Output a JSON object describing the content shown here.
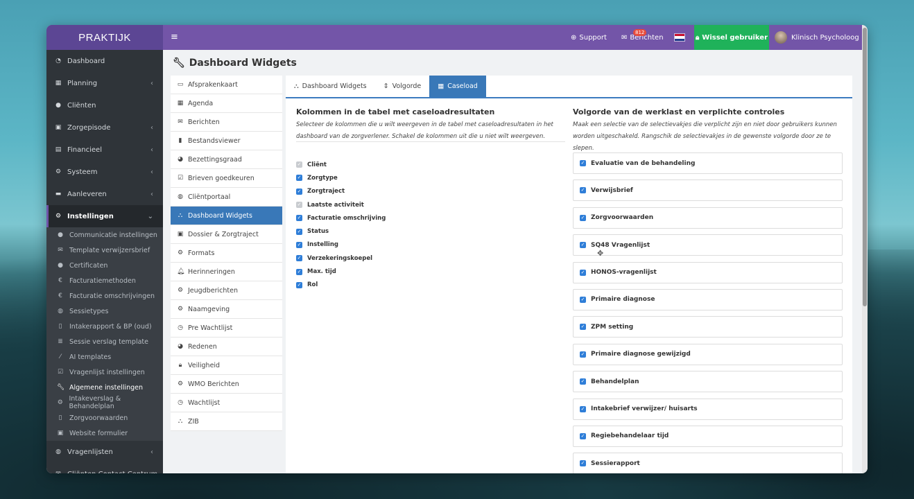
{
  "brand": "PRAKTIJK",
  "topbar": {
    "support": "Support",
    "berichten": "Berichten",
    "berichten_badge": "812",
    "wissel": "Wissel gebruiker",
    "user": "Klinisch Psycholoog"
  },
  "sidebar": {
    "items": [
      {
        "label": "Dashboard",
        "icon": "dashboard-icon"
      },
      {
        "label": "Planning",
        "icon": "calendar-icon",
        "chevron": "‹"
      },
      {
        "label": "Cliënten",
        "icon": "user-icon"
      },
      {
        "label": "Zorgepisode",
        "icon": "briefcase-icon",
        "chevron": "‹"
      },
      {
        "label": "Financieel",
        "icon": "book-icon",
        "chevron": "‹"
      },
      {
        "label": "Systeem",
        "icon": "gears-icon",
        "chevron": "‹"
      },
      {
        "label": "Aanleveren",
        "icon": "truck-icon",
        "chevron": "‹"
      },
      {
        "label": "Instellingen",
        "icon": "gear-icon",
        "chevron": "⌄"
      }
    ],
    "sub_items": [
      {
        "label": "Communicatie instellingen",
        "icon": "comments-icon"
      },
      {
        "label": "Template verwijzersbrief",
        "icon": "envelope-icon"
      },
      {
        "label": "Certificaten",
        "icon": "certificate-icon"
      },
      {
        "label": "Facturatiemethoden",
        "icon": "euro-icon"
      },
      {
        "label": "Facturatie omschrijvingen",
        "icon": "euro-icon"
      },
      {
        "label": "Sessietypes",
        "icon": "globe-icon"
      },
      {
        "label": "Intakerapport & BP (oud)",
        "icon": "file-icon"
      },
      {
        "label": "Sessie verslag template",
        "icon": "list-icon"
      },
      {
        "label": "AI templates",
        "icon": "magic-icon"
      },
      {
        "label": "Vragenlijst instellingen",
        "icon": "check-square-icon"
      },
      {
        "label": "Algemene instellingen",
        "icon": "wrench-icon"
      },
      {
        "label": "Intakeverslag & Behandelplan",
        "icon": "gear-icon"
      },
      {
        "label": "Zorgvoorwaarden",
        "icon": "document-icon"
      },
      {
        "label": "Website formulier",
        "icon": "briefcase-icon"
      }
    ],
    "after_items": [
      {
        "label": "Vragenlijsten",
        "icon": "question-icon",
        "chevron": "‹"
      },
      {
        "label": "Cliënten Contact Centrum",
        "icon": "envelope-icon",
        "chevron": "‹"
      }
    ]
  },
  "page_title": "Dashboard Widgets",
  "left_nav": [
    "Afsprakenkaart",
    "Agenda",
    "Berichten",
    "Bestandsviewer",
    "Bezettingsgraad",
    "Brieven goedkeuren",
    "Cliëntportaal",
    "Dashboard Widgets",
    "Dossier & Zorgtraject",
    "Formats",
    "Herinneringen",
    "Jeugdberichten",
    "Naamgeving",
    "Pre Wachtlijst",
    "Redenen",
    "Veiligheid",
    "WMO Berichten",
    "Wachtlijst",
    "ZIB"
  ],
  "left_nav_active": "Dashboard Widgets",
  "tabs": [
    {
      "label": "Dashboard Widgets",
      "icon": "sitemap-icon"
    },
    {
      "label": "Volgorde",
      "icon": "sort-icon"
    },
    {
      "label": "Caseload",
      "icon": "table-icon"
    }
  ],
  "columns_section": {
    "title": "Kolommen in de tabel met caseloadresultaten",
    "description_line1": "Selecteer de kolommen die u wilt weergeven in de tabel met caseloadresultaten in het",
    "description_line2": "dashboard van de zorgverlener. Schakel de kolommen uit die u niet wilt weergeven.",
    "columns": [
      {
        "label": "Cliënt",
        "checked": true,
        "disabled": true
      },
      {
        "label": "Zorgtype",
        "checked": true
      },
      {
        "label": "Zorgtraject",
        "checked": true
      },
      {
        "label": "Laatste activiteit",
        "checked": true,
        "disabled": true
      },
      {
        "label": "Facturatie omschrijving",
        "checked": true
      },
      {
        "label": "Status",
        "checked": true
      },
      {
        "label": "Instelling",
        "checked": true
      },
      {
        "label": "Verzekeringskoepel",
        "checked": true
      },
      {
        "label": "Max. tijd",
        "checked": true
      },
      {
        "label": "Rol",
        "checked": true
      }
    ]
  },
  "order_section": {
    "title": "Volgorde van de werklast en verplichte controles",
    "description_line1": "Maak een selectie van de selectievakjes die verplicht zijn en niet door gebruikers kunnen",
    "description_line2": "worden uitgeschakeld. Rangschik de selectievakjes in de gewenste volgorde door ze te slepen.",
    "items": [
      "Evaluatie van de behandeling",
      "Verwijsbrief",
      "Zorgvoorwaarden",
      "SQ48 Vragenlijst",
      "HONOS-vragenlijst",
      "Primaire diagnose",
      "ZPM setting",
      "Primaire diagnose gewijzigd",
      "Behandelplan",
      "Intakebrief verwijzer/ huisarts",
      "Regiebehandelaar tijd",
      "Sessierapport"
    ]
  },
  "colors": {
    "purple": "#7355a8",
    "brand": "#5c4694",
    "green": "#1fb25a",
    "blue": "#3978b8"
  }
}
